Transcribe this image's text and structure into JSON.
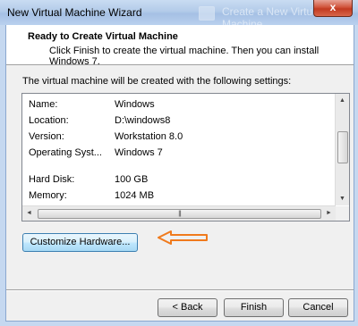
{
  "window": {
    "title": "New Virtual Machine Wizard",
    "background_window_title": "Create a New Virtual Machine",
    "close_glyph": "x"
  },
  "header": {
    "title": "Ready to Create Virtual Machine",
    "subtitle": "Click Finish to create the virtual machine. Then you can install Windows 7."
  },
  "intro": "The virtual machine will be created with the following settings:",
  "settings": [
    {
      "key": "Name:",
      "value": "Windows"
    },
    {
      "key": "Location:",
      "value": "D:\\windows8"
    },
    {
      "key": "Version:",
      "value": "Workstation 8.0"
    },
    {
      "key": "Operating Syst...",
      "value": "Windows 7"
    },
    {
      "key": "Hard Disk:",
      "value": "100 GB"
    },
    {
      "key": "Memory:",
      "value": "1024 MB"
    }
  ],
  "scrollbar_glyphs": {
    "up": "▲",
    "down": "▼",
    "left": "◄",
    "right": "►",
    "grip": "|||"
  },
  "buttons": {
    "customize": "Customize Hardware...",
    "back": "< Back",
    "finish": "Finish",
    "cancel": "Cancel"
  },
  "colors": {
    "annotation_arrow": "#f07a1c",
    "title_gradient": "#b3cbe9",
    "close_button": "#c23a21"
  },
  "icons": [
    "close-icon",
    "annotation-arrow-icon"
  ]
}
